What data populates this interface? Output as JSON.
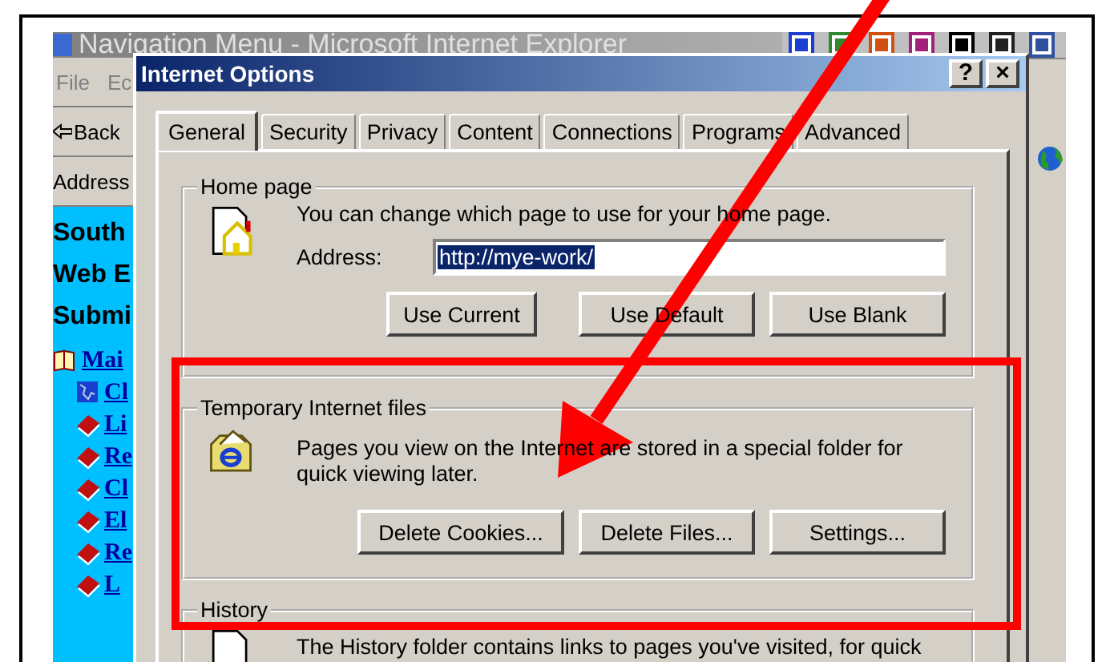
{
  "browser": {
    "title": "Navigation Menu - Microsoft Internet Explorer",
    "menu": [
      "File",
      "Ec"
    ],
    "toolbar": [
      "Back"
    ],
    "address_label": "Address",
    "sidebar": {
      "headings": [
        "South",
        "Web E",
        "Submi"
      ],
      "tree": [
        {
          "label": "Mai",
          "kind": "open-book",
          "children": [
            {
              "label": "Cl",
              "kind": "map"
            },
            {
              "label": "Li",
              "kind": "book"
            },
            {
              "label": "Re",
              "kind": "book"
            },
            {
              "label": "Cl",
              "kind": "book"
            },
            {
              "label": "El",
              "kind": "book"
            },
            {
              "label": "Re",
              "kind": "book"
            },
            {
              "label": "L",
              "kind": "book"
            }
          ]
        }
      ]
    }
  },
  "dialog": {
    "title": "Internet Options",
    "title_buttons": [
      "?",
      "×"
    ],
    "tabs": [
      {
        "label": "General",
        "selected": true
      },
      {
        "label": "Security",
        "selected": false
      },
      {
        "label": "Privacy",
        "selected": false
      },
      {
        "label": "Content",
        "selected": false
      },
      {
        "label": "Connections",
        "selected": false
      },
      {
        "label": "Programs",
        "selected": false
      },
      {
        "label": "Advanced",
        "selected": false
      }
    ],
    "groups": [
      {
        "title": "Home page",
        "kind": "home",
        "text": "You can change which page to use for your home page.",
        "address": {
          "label": "Address:",
          "value": "http://mye-work/",
          "selected": true
        },
        "buttons": [
          "Use Current",
          "Use Default",
          "Use Blank"
        ]
      },
      {
        "title": "Temporary Internet files",
        "kind": "cache",
        "text": "Pages you view on the Internet are stored in a special folder for quick viewing later.",
        "buttons": [
          "Delete Cookies...",
          "Delete Files...",
          "Settings..."
        ]
      },
      {
        "title": "History",
        "kind": "history",
        "text": "The History folder contains links to pages you've visited, for quick"
      }
    ]
  }
}
